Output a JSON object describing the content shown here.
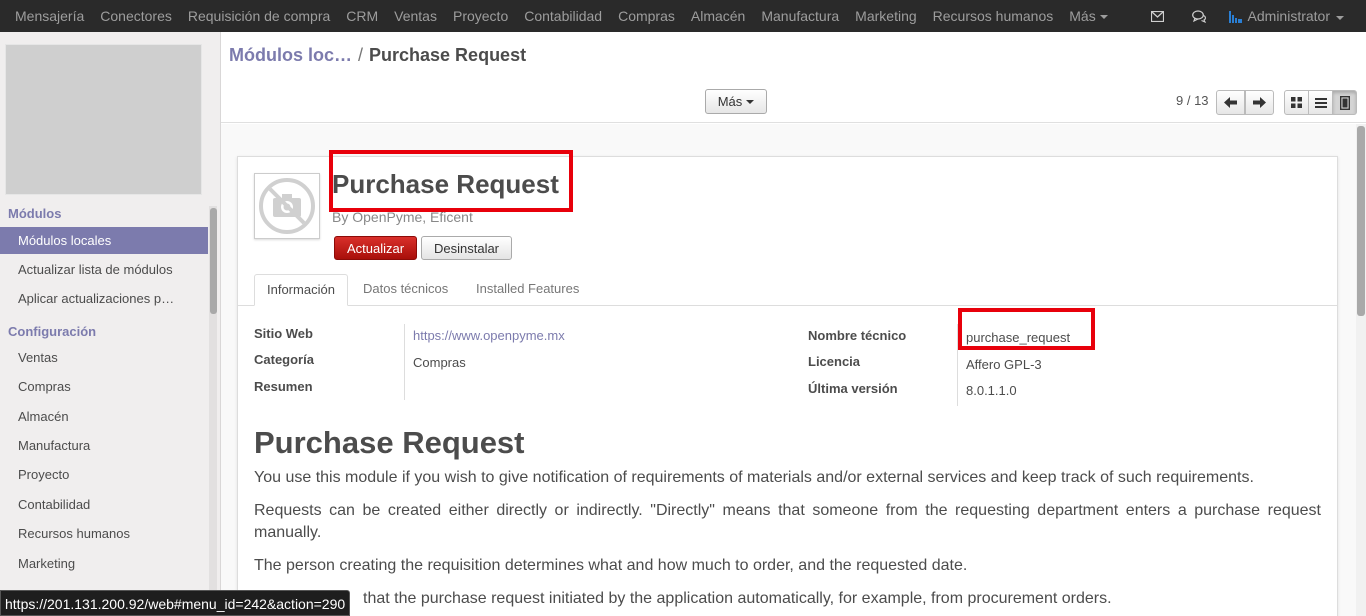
{
  "topnav": {
    "menu": [
      "Mensajería",
      "Conectores",
      "Requisición de compra",
      "CRM",
      "Ventas",
      "Proyecto",
      "Contabilidad",
      "Compras",
      "Almacén",
      "Manufactura",
      "Marketing",
      "Recursos humanos"
    ],
    "more_label": "Más",
    "user_label": "Administrator"
  },
  "sidebar": {
    "section1": "Módulos",
    "section1_items": [
      "Módulos locales",
      "Actualizar lista de módulos",
      "Aplicar actualizaciones p…"
    ],
    "section2": "Configuración",
    "section2_items": [
      "Ventas",
      "Compras",
      "Almacén",
      "Manufactura",
      "Proyecto",
      "Contabilidad",
      "Recursos humanos",
      "Marketing"
    ]
  },
  "breadcrumb": {
    "parent": "Módulos loc…",
    "separator": "/",
    "current": "Purchase Request"
  },
  "toolbar": {
    "more_label": "Más",
    "pager": "9 / 13"
  },
  "module": {
    "title": "Purchase Request",
    "author": "By OpenPyme, Eficent",
    "update_label": "Actualizar",
    "uninstall_label": "Desinstalar"
  },
  "tabs": [
    "Información",
    "Datos técnicos",
    "Installed Features"
  ],
  "fields": {
    "website_label": "Sitio Web",
    "website_value": "https://www.openpyme.mx",
    "category_label": "Categoría",
    "category_value": "Compras",
    "summary_label": "Resumen",
    "technical_label": "Nombre técnico",
    "technical_value": "purchase_request",
    "license_label": "Licencia",
    "license_value": "Affero GPL-3",
    "version_label": "Última versión",
    "version_value": "8.0.1.1.0"
  },
  "description": {
    "heading": "Purchase Request",
    "paragraphs": [
      "You use this module if you wish to give notification of requirements of materials and/or external services and keep track of such requirements.",
      "Requests can be created either directly or indirectly. \"Directly\" means that someone from the requesting department enters a purchase request manually.",
      "The person creating the requisition determines what and how much to order, and the requested date.",
      "that the purchase request initiated by the application automatically, for example, from procurement orders."
    ]
  },
  "status_url": "https://201.131.200.92/web#menu_id=242&action=290",
  "colors": {
    "topbar": "#2a2a2a",
    "accent": "#7c7bad",
    "highlight": "#e8000b",
    "update_button": "#c9221c"
  }
}
